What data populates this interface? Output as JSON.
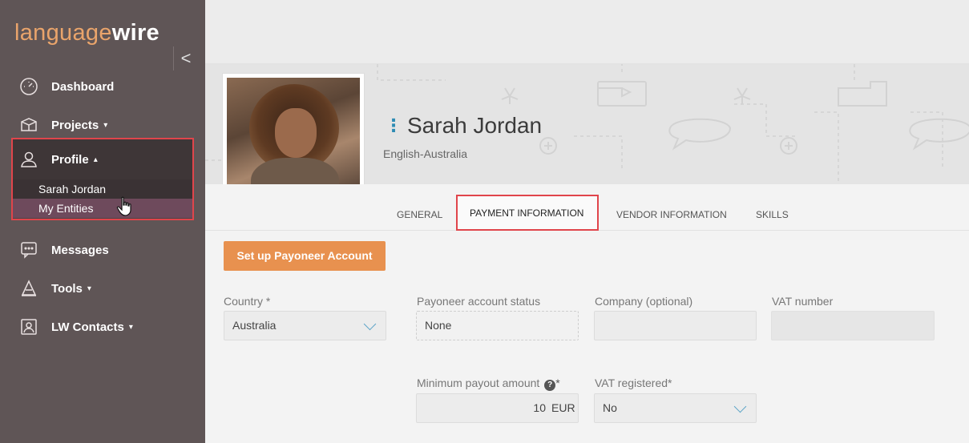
{
  "app": {
    "logo_part1": "language",
    "logo_part2": "wire",
    "collapse_label": "<"
  },
  "sidebar": {
    "items": [
      {
        "label": "Dashboard",
        "icon": "dashboard-icon"
      },
      {
        "label": "Projects",
        "icon": "box-icon",
        "caret": "▾"
      },
      {
        "label": "Profile",
        "icon": "user-icon",
        "caret": "▴"
      },
      {
        "label": "Messages",
        "icon": "chat-icon"
      },
      {
        "label": "Tools",
        "icon": "tools-icon",
        "caret": "▾"
      },
      {
        "label": "LW Contacts",
        "icon": "contacts-icon",
        "caret": "▾"
      }
    ],
    "profile_sub": [
      "Sarah Jordan",
      "My Entities"
    ]
  },
  "profile": {
    "name": "Sarah Jordan",
    "locale": "English-Australia"
  },
  "tabs": [
    "GENERAL",
    "PAYMENT INFORMATION",
    "VENDOR INFORMATION",
    "SKILLS"
  ],
  "form": {
    "payoneer_button": "Set up Payoneer Account",
    "country_label": "Country *",
    "country_value": "Australia",
    "status_label": "Payoneer account status",
    "status_value": "None",
    "company_label": "Company (optional)",
    "company_value": "",
    "vat_number_label": "VAT number",
    "vat_number_value": "",
    "min_payout_label": "Minimum payout amount",
    "min_payout_required": "*",
    "min_payout_value": "10",
    "min_payout_unit": "EUR",
    "vat_registered_label": "VAT registered*",
    "vat_registered_value": "No"
  },
  "colors": {
    "sidebar_bg": "#5f5556",
    "accent_orange": "#e8914f",
    "highlight_red": "#e0454b",
    "link_blue": "#2d8bb3"
  }
}
